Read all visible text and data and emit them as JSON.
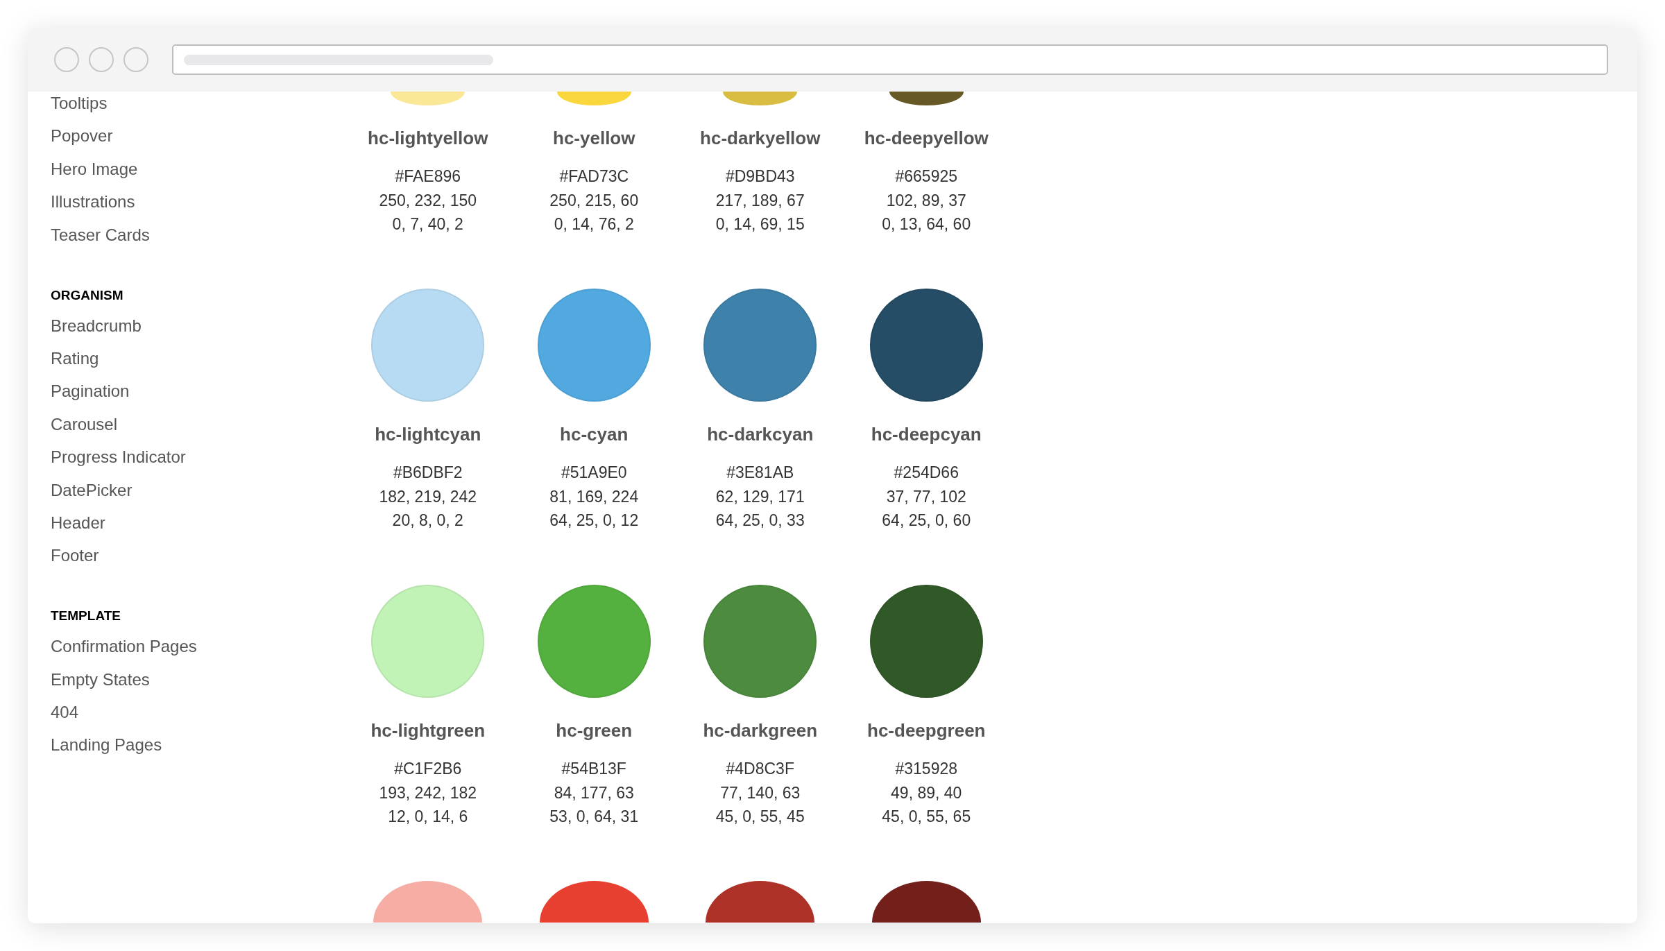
{
  "sidebar": {
    "sections": [
      {
        "items": [
          "Tooltips",
          "Popover",
          "Hero Image",
          "Illustrations",
          "Teaser Cards"
        ]
      },
      {
        "heading": "ORGANISM",
        "items": [
          "Breadcrumb",
          "Rating",
          "Pagination",
          "Carousel",
          "Progress Indicator",
          "DatePicker",
          "Header",
          "Footer"
        ]
      },
      {
        "heading": "TEMPLATE",
        "items": [
          "Confirmation Pages",
          "Empty States",
          "404",
          "Landing Pages"
        ]
      }
    ]
  },
  "palette": {
    "rows": [
      {
        "swatches": [
          {
            "name": "hc-lightyellow",
            "hex": "#FAE896",
            "rgb": "250, 232, 150",
            "cmyk": "0, 7, 40, 2",
            "color": "#fae896"
          },
          {
            "name": "hc-yellow",
            "hex": "#FAD73C",
            "rgb": "250, 215, 60",
            "cmyk": "0, 14, 76, 2",
            "color": "#fad73c"
          },
          {
            "name": "hc-darkyellow",
            "hex": "#D9BD43",
            "rgb": "217, 189, 67",
            "cmyk": "0, 14, 69, 15",
            "color": "#d9bd43"
          },
          {
            "name": "hc-deepyellow",
            "hex": "#665925",
            "rgb": "102, 89, 37",
            "cmyk": "0, 13, 64, 60",
            "color": "#665925"
          }
        ]
      },
      {
        "swatches": [
          {
            "name": "hc-lightcyan",
            "hex": "#B6DBF2",
            "rgb": "182, 219, 242",
            "cmyk": "20, 8, 0, 2",
            "color": "#b6dbf2"
          },
          {
            "name": "hc-cyan",
            "hex": "#51A9E0",
            "rgb": "81, 169, 224",
            "cmyk": "64, 25, 0, 12",
            "color": "#51a9e0"
          },
          {
            "name": "hc-darkcyan",
            "hex": "#3E81AB",
            "rgb": "62, 129, 171",
            "cmyk": "64, 25, 0, 33",
            "color": "#3e81ab"
          },
          {
            "name": "hc-deepcyan",
            "hex": "#254D66",
            "rgb": "37, 77, 102",
            "cmyk": "64, 25, 0, 60",
            "color": "#254d66"
          }
        ]
      },
      {
        "swatches": [
          {
            "name": "hc-lightgreen",
            "hex": "#C1F2B6",
            "rgb": "193, 242, 182",
            "cmyk": "12, 0, 14, 6",
            "color": "#c1f2b6"
          },
          {
            "name": "hc-green",
            "hex": "#54B13F",
            "rgb": "84, 177, 63",
            "cmyk": "53, 0, 64, 31",
            "color": "#54b13f"
          },
          {
            "name": "hc-darkgreen",
            "hex": "#4D8C3F",
            "rgb": "77, 140, 63",
            "cmyk": "45, 0, 55, 45",
            "color": "#4d8c3f"
          },
          {
            "name": "hc-deepgreen",
            "hex": "#315928",
            "rgb": "49, 89, 40",
            "cmyk": "45, 0, 55, 65",
            "color": "#315928"
          }
        ]
      },
      {
        "swatches": [
          {
            "color": "#f5ada4"
          },
          {
            "color": "#e74030"
          },
          {
            "color": "#ae3128"
          },
          {
            "color": "#73201b"
          }
        ]
      }
    ]
  }
}
